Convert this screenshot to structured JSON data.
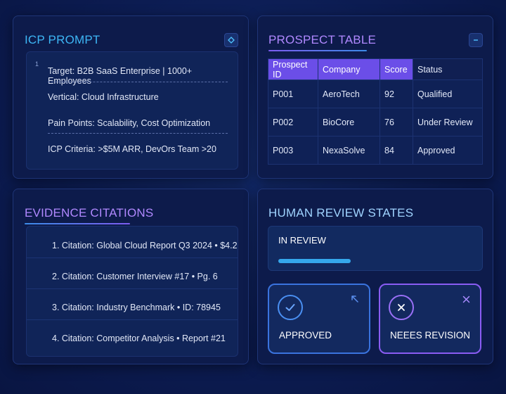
{
  "icp_prompt": {
    "title": "ICP PROMPT",
    "line_number": "1",
    "lines": [
      "Target: B2B SaaS Enterprise | 1000+ Employees",
      "Vertical: Cloud Infrastructure",
      "Pain Points: Scalability, Cost Optimization",
      "ICP Criteria: >$5M ARR, DevOrs Team >20"
    ],
    "corner_icon": "diamond-icon"
  },
  "prospect_table": {
    "title": "PROSPECT TABLE",
    "collapse_icon": "minus-icon",
    "columns": [
      "Prospect ID",
      "Company",
      "Score",
      "Status"
    ],
    "rows": [
      [
        "P001",
        "AeroTech",
        "92",
        "Qualified"
      ],
      [
        "P002",
        "BioCore",
        "76",
        "Under Review"
      ],
      [
        "P003",
        "NexaSolve",
        "84",
        "Approved"
      ]
    ]
  },
  "evidence": {
    "title": "EVIDENCE CITATIONS",
    "citations": [
      "1. Citation: Global Cloud Report Q3 2024 • $4.2",
      "2. Citation: Customer Interview #17 • Pg. 6",
      "3. Citation: Industry Benchmark • ID: 78945",
      "4. Citation: Competitor Analysis • Report #21"
    ]
  },
  "review": {
    "title": "HUMAN REVIEW STATES",
    "in_review_label": "IN REVIEW",
    "progress_fraction": 0.37,
    "approved_label": "APPROVED",
    "revision_label": "NEEES REVISION",
    "colors": {
      "approved": "#3a73de",
      "revision": "#8a5cf3",
      "progress": "#35a8ec"
    }
  }
}
